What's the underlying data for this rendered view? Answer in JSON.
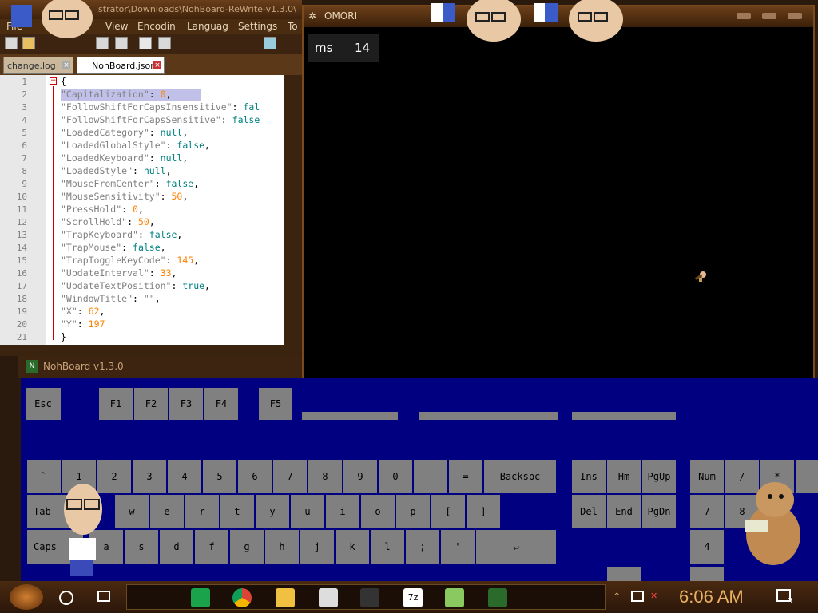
{
  "notepad": {
    "title_path": "istrator\\Downloads\\NohBoard-ReWrite-v1.3.0\\",
    "menu": [
      "File",
      "View",
      "Encodin",
      "Languag",
      "Settings",
      "To"
    ],
    "tabs": [
      {
        "label": "change.log",
        "active": false
      },
      {
        "label": "NohBoard.json",
        "active": true
      }
    ],
    "line_numbers": [
      "1",
      "2",
      "3",
      "4",
      "5",
      "6",
      "7",
      "8",
      "9",
      "10",
      "11",
      "12",
      "13",
      "14",
      "15",
      "16",
      "17",
      "18",
      "19",
      "20",
      "21"
    ],
    "lines": [
      {
        "key": "{",
        "sep": "",
        "val": "",
        "type": "p"
      },
      {
        "key": "\"Capitalization\"",
        "sep": ": ",
        "val": "0",
        "type": "n",
        "tail": ","
      },
      {
        "key": "\"FollowShiftForCapsInsensitive\"",
        "sep": ": ",
        "val": "fal",
        "type": "b",
        "tail": ""
      },
      {
        "key": "\"FollowShiftForCapsSensitive\"",
        "sep": ": ",
        "val": "false",
        "type": "b",
        "tail": ""
      },
      {
        "key": "\"LoadedCategory\"",
        "sep": ": ",
        "val": "null",
        "type": "b",
        "tail": ","
      },
      {
        "key": "\"LoadedGlobalStyle\"",
        "sep": ": ",
        "val": "false",
        "type": "b",
        "tail": ","
      },
      {
        "key": "\"LoadedKeyboard\"",
        "sep": ": ",
        "val": "null",
        "type": "b",
        "tail": ","
      },
      {
        "key": "\"LoadedStyle\"",
        "sep": ": ",
        "val": "null",
        "type": "b",
        "tail": ","
      },
      {
        "key": "\"MouseFromCenter\"",
        "sep": ": ",
        "val": "false",
        "type": "b",
        "tail": ","
      },
      {
        "key": "\"MouseSensitivity\"",
        "sep": ": ",
        "val": "50",
        "type": "n",
        "tail": ","
      },
      {
        "key": "\"PressHold\"",
        "sep": ": ",
        "val": "0",
        "type": "n",
        "tail": ","
      },
      {
        "key": "\"ScrollHold\"",
        "sep": ": ",
        "val": "50",
        "type": "n",
        "tail": ","
      },
      {
        "key": "\"TrapKeyboard\"",
        "sep": ": ",
        "val": "false",
        "type": "b",
        "tail": ","
      },
      {
        "key": "\"TrapMouse\"",
        "sep": ": ",
        "val": "false",
        "type": "b",
        "tail": ","
      },
      {
        "key": "\"TrapToggleKeyCode\"",
        "sep": ": ",
        "val": "145",
        "type": "n",
        "tail": ","
      },
      {
        "key": "\"UpdateInterval\"",
        "sep": ": ",
        "val": "33",
        "type": "n",
        "tail": ","
      },
      {
        "key": "\"UpdateTextPosition\"",
        "sep": ": ",
        "val": "true",
        "type": "b",
        "tail": ","
      },
      {
        "key": "\"WindowTitle\"",
        "sep": ": ",
        "val": "\"\"",
        "type": "s",
        "tail": ","
      },
      {
        "key": "\"X\"",
        "sep": ": ",
        "val": "62",
        "type": "n",
        "tail": ","
      },
      {
        "key": "\"Y\"",
        "sep": ": ",
        "val": "197",
        "type": "n",
        "tail": ""
      },
      {
        "key": "}",
        "sep": "",
        "val": "",
        "type": "p"
      }
    ]
  },
  "omori": {
    "title": "OMORI",
    "fps_label": "ms",
    "fps_value": "14"
  },
  "nohboard": {
    "title": "NohBoard v1.3.0",
    "keys": {
      "esc": "Esc",
      "f1": "F1",
      "f2": "F2",
      "f3": "F3",
      "f4": "F4",
      "f5": "F5",
      "backtick": "`",
      "n1": "1",
      "n2": "2",
      "n3": "3",
      "n4": "4",
      "n5": "5",
      "n6": "6",
      "n7": "7",
      "n8": "8",
      "n9": "9",
      "n0": "0",
      "minus": "-",
      "equals": "=",
      "backspace": "Backspc",
      "tab": "Tab",
      "q": "q",
      "w": "w",
      "e": "e",
      "r": "r",
      "t": "t",
      "y": "y",
      "u": "u",
      "i": "i",
      "o": "o",
      "p": "p",
      "lbracket": "[",
      "rbracket": "]",
      "caps": "Caps",
      "a": "a",
      "s": "s",
      "d": "d",
      "f": "f",
      "g": "g",
      "h": "h",
      "j": "j",
      "k": "k",
      "l": "l",
      "semicolon": ";",
      "quote": "'",
      "enter": "↵",
      "ins": "Ins",
      "home": "Hm",
      "pgup": "PgUp",
      "del": "Del",
      "end": "End",
      "pgdn": "PgDn",
      "numlock": "Num",
      "divide": "/",
      "multiply": "*",
      "np7": "7",
      "np8": "8",
      "np4": "4"
    }
  },
  "taskbar": {
    "clock": "6:06 AM",
    "notification_count": "3",
    "icons": [
      "sheets-icon",
      "chrome-icon",
      "file-explorer-icon",
      "skull-icon",
      "pirate-icon",
      "7zip-icon",
      "notepadpp-icon",
      "nohboard-icon"
    ]
  },
  "colors": {
    "editor_key": "#808080",
    "editor_bool": "#008080",
    "editor_number": "#ff8000",
    "nohboard_bg": "#000080",
    "key_fill": "#808080",
    "clock": "#e8b060"
  }
}
